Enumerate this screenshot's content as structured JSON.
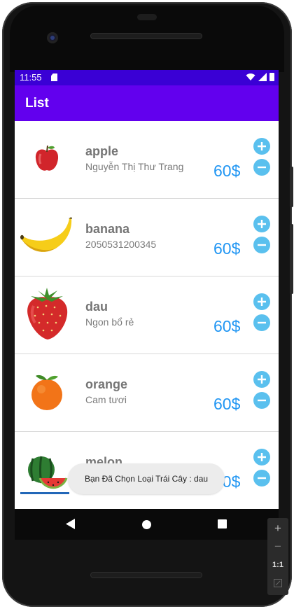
{
  "status_bar": {
    "time": "11:55"
  },
  "app_bar": {
    "title": "List"
  },
  "items": [
    {
      "name": "apple",
      "description": "Nguyễn Thị Thư Trang",
      "price": "60$",
      "icon": "apple-icon"
    },
    {
      "name": "banana",
      "description": "2050531200345",
      "price": "60$",
      "icon": "banana-icon"
    },
    {
      "name": "dau",
      "description": "Ngon bổ rẻ",
      "price": "60$",
      "icon": "strawberry-icon"
    },
    {
      "name": "orange",
      "description": "Cam tươi",
      "price": "60$",
      "icon": "orange-icon"
    },
    {
      "name": "melon",
      "description": "",
      "price": "60$",
      "icon": "watermelon-icon"
    }
  ],
  "toast": {
    "message": "Bạn Đã Chọn Loại Trái Cây : dau"
  },
  "zoom_panel": {
    "zoom_in": "+",
    "zoom_out": "−",
    "ratio": "1:1"
  },
  "colors": {
    "app_bar": "#6200ee",
    "status_bar": "#3a00d5",
    "price": "#2196f3",
    "round_button": "#5ac0ee"
  }
}
